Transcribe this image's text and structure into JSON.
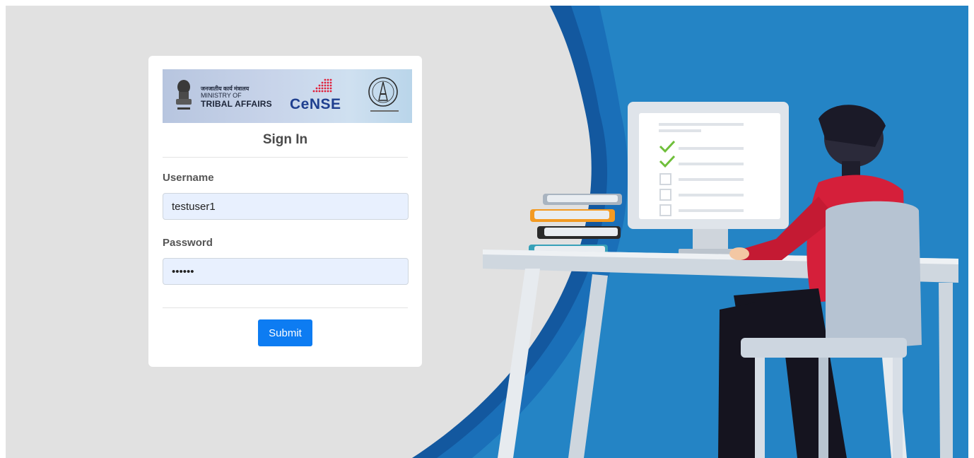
{
  "banner": {
    "ministry_hindi": "जनजातीय कार्य मंत्रालय",
    "ministry_line1": "MINISTRY OF",
    "ministry_line2": "TRIBAL AFFAIRS",
    "cense_logo": "CeNSE",
    "emblem_icon": "ashoka-emblem-icon",
    "seal_icon": "institute-seal-icon"
  },
  "form": {
    "title": "Sign In",
    "username_label": "Username",
    "username_value": "testuser1",
    "password_label": "Password",
    "password_value": "••••••",
    "submit_label": "Submit"
  },
  "colors": {
    "page_bg": "#e1e1e1",
    "accent_blue": "#2484c5",
    "dark_blue": "#13589f",
    "button_blue": "#0d7cf2",
    "shirt_red": "#d51f3a"
  },
  "illustration": {
    "description_icon": "person-at-computer-illustration-icon"
  }
}
